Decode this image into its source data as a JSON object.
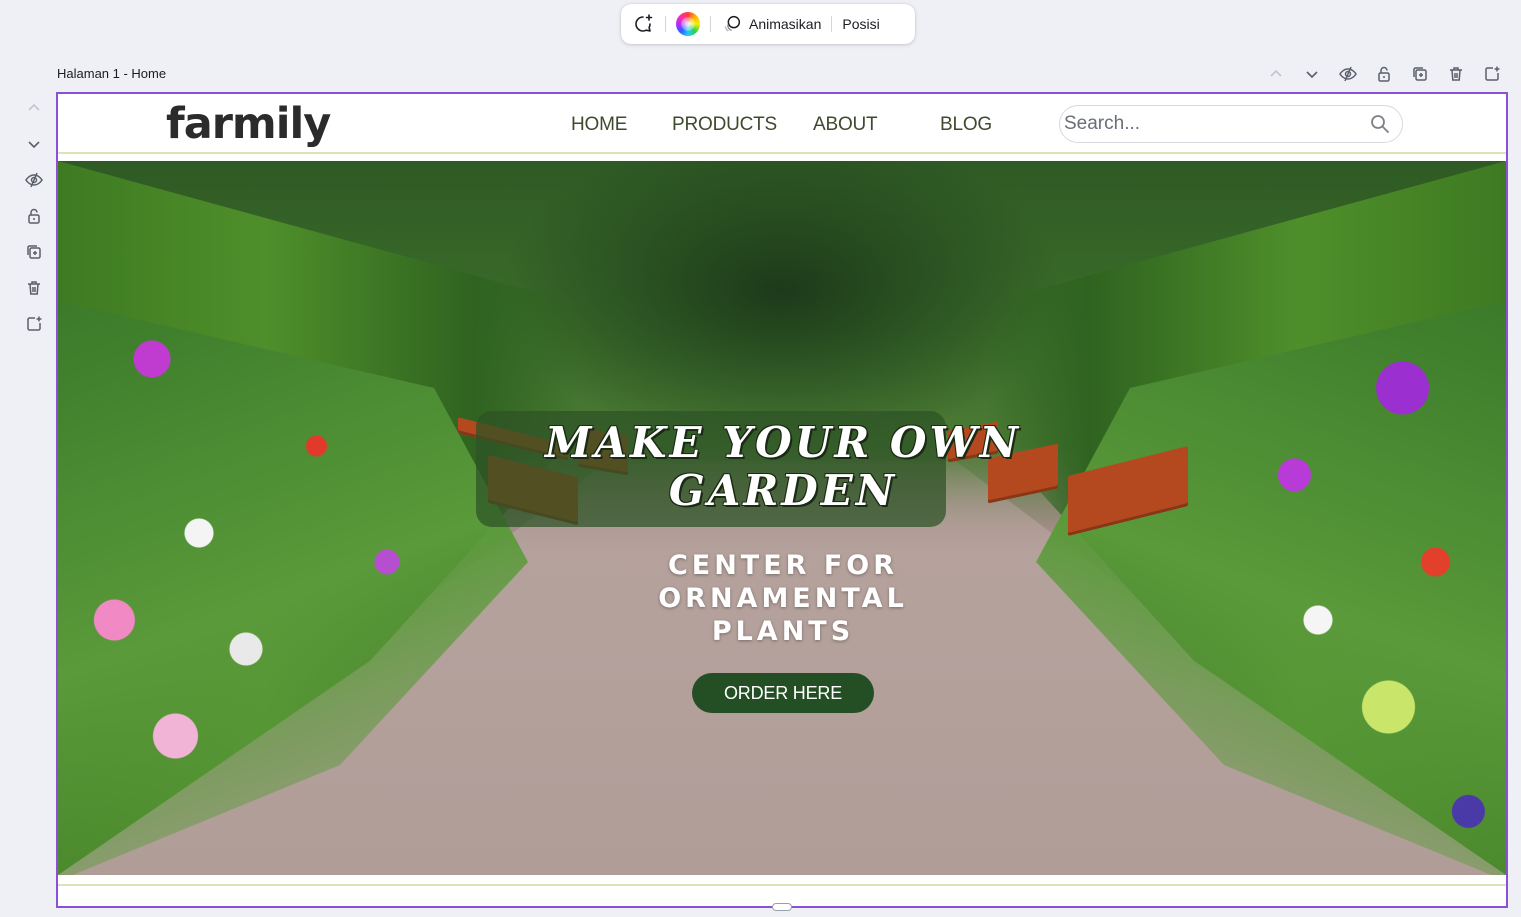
{
  "context_toolbar": {
    "comment_icon": "comment-add-icon",
    "color_icon": "color-wheel-icon",
    "animate_label": "Animasikan",
    "position_label": "Posisi"
  },
  "page": {
    "label": "Halaman 1 - Home"
  },
  "page_actions": [
    "chevron-up-icon",
    "chevron-down-icon",
    "eye-hide-icon",
    "lock-icon",
    "duplicate-icon",
    "trash-icon",
    "add-page-icon"
  ],
  "site": {
    "logo_text": "farmily",
    "nav": [
      "HOME",
      "PRODUCTS",
      "ABOUT",
      "BLOG"
    ],
    "search_placeholder": "Search...",
    "hero": {
      "title": "MAKE YOUR OWN GARDEN",
      "subtitle": "CENTER FOR ORNAMENTAL PLANTS",
      "cta": "ORDER HERE"
    }
  },
  "colors": {
    "selection_border": "#8b4fd8",
    "cta_bg": "#244e24",
    "accent_line": "#d9e5b8",
    "logo_dot": "#8dc63f"
  }
}
